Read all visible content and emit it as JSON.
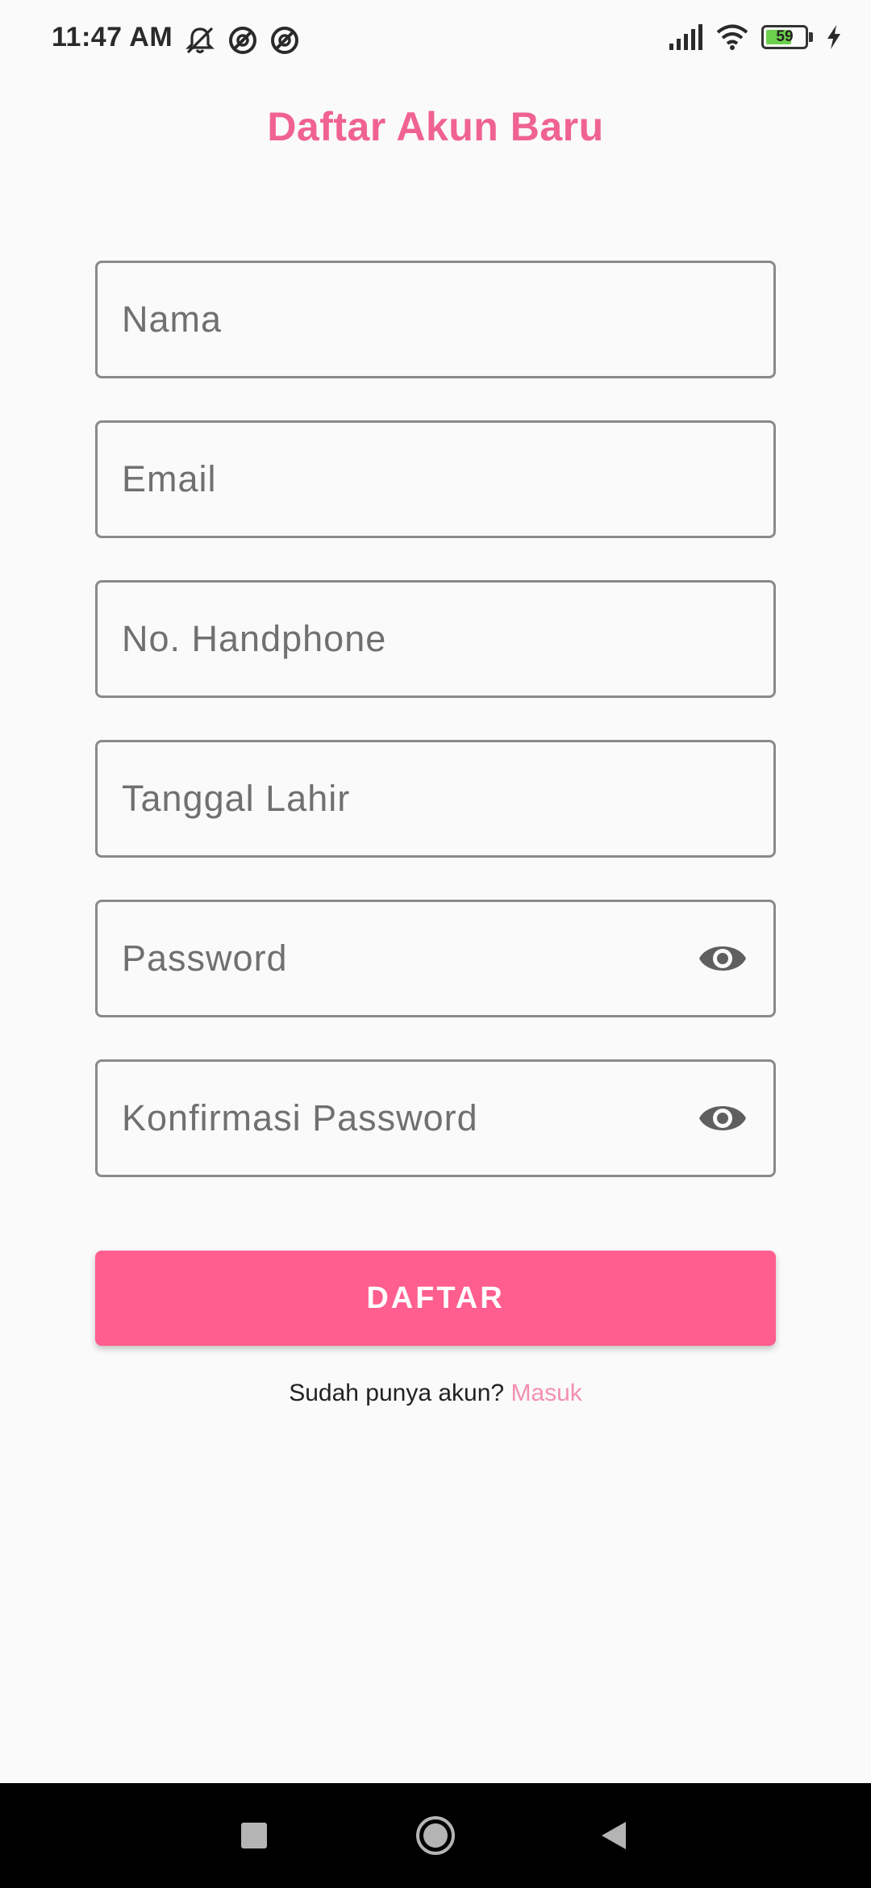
{
  "status_bar": {
    "time": "11:47 AM",
    "battery_level": "59",
    "battery_fraction": 0.59,
    "left_icons": [
      "notifications-muted-icon",
      "blocked-circle-icon",
      "blocked-circle-icon"
    ],
    "right_icons": [
      "cellular-signal-icon",
      "wifi-icon",
      "battery-icon",
      "charging-bolt-icon"
    ]
  },
  "header": {
    "title": "Daftar Akun Baru",
    "title_color": "#f06292"
  },
  "form": {
    "fields": [
      {
        "placeholder": "Nama",
        "value": ""
      },
      {
        "placeholder": "Email",
        "value": ""
      },
      {
        "placeholder": "No. Handphone",
        "value": ""
      },
      {
        "placeholder": "Tanggal Lahir",
        "value": ""
      },
      {
        "placeholder": "Password",
        "value": "",
        "icon": "eye-icon"
      },
      {
        "placeholder": "Konfirmasi Password",
        "value": "",
        "icon": "eye-icon"
      }
    ],
    "submit_label": "DAFTAR",
    "submit_color": "#ff5e8e"
  },
  "footer": {
    "prompt": "Sudah punya akun?",
    "link_label": "Masuk",
    "link_color": "#f48fb1"
  },
  "nav_bar": {
    "buttons": [
      "recents-square-icon",
      "home-circle-icon",
      "back-triangle-icon"
    ]
  }
}
